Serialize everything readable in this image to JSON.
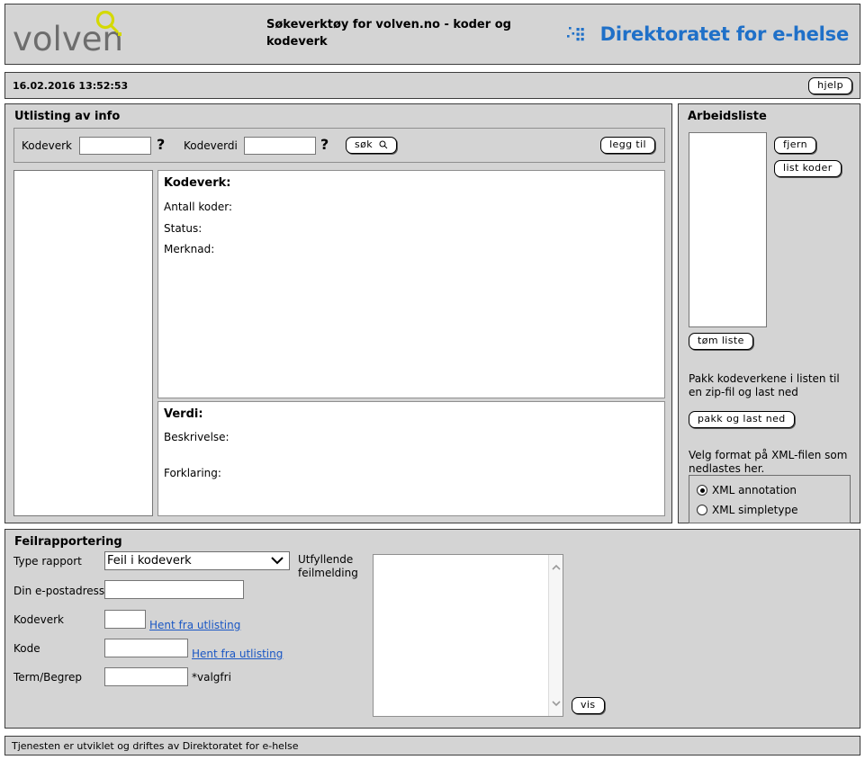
{
  "header": {
    "logo_text": "volven",
    "logo_icon": "magnifier-icon",
    "site_title": "Søkeverktøy for volven.no - koder og kodeverk",
    "brand_text": "Direktoratet for e-helse",
    "brand_icon": "ehelse-dots-icon",
    "brand_color": "#1f70c8",
    "logo_color": "#6d6d6d",
    "logo_accent_color": "#d4d900"
  },
  "datebar": {
    "timestamp": "16.02.2016 13:52:53",
    "help_label": "hjelp"
  },
  "utlisting": {
    "title": "Utlisting av info",
    "search": {
      "kodeverk_label": "Kodeverk",
      "kodeverk_value": "",
      "kodeverk_help": "?",
      "kodeverdi_label": "Kodeverdi",
      "kodeverdi_value": "",
      "kodeverdi_help": "?",
      "search_label": "søk",
      "add_label": "legg til"
    },
    "results_list": [],
    "kodeverk_info": {
      "heading": "Kodeverk:",
      "rows": [
        {
          "label": "Antall koder:",
          "value": ""
        },
        {
          "label": "Status:",
          "value": ""
        },
        {
          "label": "Merknad:",
          "value": ""
        }
      ]
    },
    "verdi_info": {
      "heading": "Verdi:",
      "rows": [
        {
          "label": "Beskrivelse:",
          "value": ""
        },
        {
          "label": "Forklaring:",
          "value": ""
        }
      ]
    }
  },
  "arbeidsliste": {
    "title": "Arbeidsliste",
    "items": [],
    "remove_label": "fjern",
    "list_codes_label": "list koder",
    "clear_label": "tøm liste",
    "pack_description": "Pakk kodeverkene i listen til en zip-fil og last ned",
    "pack_label": "pakk og last ned",
    "format_description": "Velg format på XML-filen som nedlastes her.",
    "format_options": [
      {
        "label": "XML annotation",
        "selected": true
      },
      {
        "label": "XML simpletype",
        "selected": false
      }
    ]
  },
  "feilrapportering": {
    "title": "Feilrapportering",
    "type_label": "Type rapport",
    "type_value": "Feil i kodeverk",
    "type_options": [
      "Feil i kodeverk"
    ],
    "message_label": "Utfyllende feilmelding",
    "email_label": "Din e-postadresse",
    "email_value": "",
    "kodeverk_label": "Kodeverk",
    "kodeverk_value": "",
    "kodeverk_link": "Hent fra utlisting",
    "kode_label": "Kode",
    "kode_value": "",
    "kode_link": "Hent fra utlisting",
    "term_label": "Term/Begrep",
    "term_value": "",
    "term_note": "*valgfri",
    "message_value": "",
    "submit_label": "vis",
    "link_color": "#1a57c4"
  },
  "footer": {
    "text": "Tjenesten er utviklet og driftes av Direktoratet for e-helse"
  }
}
